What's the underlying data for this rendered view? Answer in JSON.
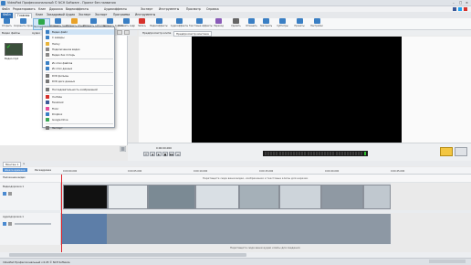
{
  "title_bar": {
    "title": "VideoPad Профессиональный © NCH Software - Проект без названия"
  },
  "menu": [
    "Файл",
    "Редактировать",
    "Клип",
    "Дорожка",
    "Видеоэффекты",
    "Аудиоэффекты",
    "Эксперт",
    "Инструменты",
    "Просмотр",
    "Справка"
  ],
  "tabs": [
    "Файл",
    "Главная",
    "Клип",
    "Закадровый",
    "Аудио",
    "Эксперт",
    "Экспорт",
    "Программа",
    "Инструменты"
  ],
  "ribbon": [
    {
      "label": "Открыть",
      "color": "#3a7fc4"
    },
    {
      "label": "Сохранить проект",
      "color": "#3a7fc4"
    },
    {
      "label": "Экспортировать файлы",
      "color": "#2ea84a"
    },
    {
      "label": "Добавить текст",
      "color": "#3a7fc4"
    },
    {
      "label": "Добавить объект",
      "color": "#e8a22a"
    },
    {
      "label": "Добавить субтитры",
      "color": "#3a7fc4"
    },
    {
      "label": "Добавить пустой",
      "color": "#3a7fc4"
    },
    {
      "label": "Добавить кадр",
      "color": "#3a7fc4"
    },
    {
      "label": "Запись",
      "color": "#d6312b"
    },
    {
      "label": "Видеоэффекты",
      "color": "#3a7fc4"
    },
    {
      "label": "Аудиоэффекты",
      "color": "#3a7fc4"
    },
    {
      "label": "Текстовые эффекты",
      "color": "#3a7fc4"
    },
    {
      "label": "Переход",
      "color": "#8a5bb8"
    },
    {
      "label": "Удалить",
      "color": "#666666"
    },
    {
      "label": "Отменить",
      "color": "#3a7fc4"
    },
    {
      "label": "Повторить",
      "color": "#3a7fc4"
    },
    {
      "label": "Субтитры",
      "color": "#3a7fc4"
    },
    {
      "label": "Проекты",
      "color": "#3a7fc4"
    },
    {
      "label": "Настройки",
      "color": "#3a7fc4"
    }
  ],
  "left_panel": {
    "tabs": [
      "Видео файлы",
      "Аудио",
      "Изображения",
      "Последовательности"
    ],
    "thumb_label": "Видео.mp4"
  },
  "dropdown": {
    "items": [
      {
        "label": "Видео файл",
        "color": "#3a7fc4"
      },
      {
        "label": "С камеры",
        "color": "#3a7fc4"
      },
      {
        "label": "Папку",
        "color": "#e8b339"
      },
      {
        "label": "Подключенное видео",
        "color": "#888888"
      },
      {
        "label": "Видео без потерь",
        "color": "#888888"
      },
      {
        "label": "Из этих файлов",
        "color": "#3a7fc4"
      },
      {
        "label": "Из этих данных",
        "color": "#3a7fc4"
      },
      {
        "label": "DVD фильмы",
        "color": "#777777"
      },
      {
        "label": "DVD диск данных",
        "color": "#777777"
      },
      {
        "label": "Последовательность изображений",
        "color": "#777777"
      },
      {
        "label": "YouTube",
        "color": "#d6312b"
      },
      {
        "label": "Facebook",
        "color": "#3b5998"
      },
      {
        "label": "Flickr",
        "color": "#e84a9a"
      },
      {
        "label": "Dropbox",
        "color": "#3a7fc4"
      },
      {
        "label": "Google Drive",
        "color": "#3aa855"
      },
      {
        "label": "Экспорт",
        "color": "#777777"
      }
    ]
  },
  "preview_tabs": [
    "Предпросмотр клипа",
    "Предпросмотр монтажа"
  ],
  "controls": {
    "timecode": "0:00:00.000",
    "buttons": [
      "⏮",
      "◀",
      "▶",
      "■",
      "▶▶",
      "⏭"
    ]
  },
  "project_tabs": [
    "Монтаж 1",
    "×"
  ],
  "timeline": {
    "header": [
      "Шкала времени",
      "Раскадровка"
    ],
    "ticks": [
      "0:00:00.000",
      "0:00:05.000",
      "0:00:10.000",
      "0:00:15.000",
      "0:00:20.000",
      "0:00:25.000"
    ],
    "hint_video": "Перетащите сюда ваши видео, изображения и текстовые клипы для нарезки",
    "hint_audio": "Перетащите сюда ваши аудио клипы для сведения",
    "overlay_label": "Наложение видео",
    "video_track_label": "Видеодорожка 1",
    "audio_track_label": "Аудиодорожка 1"
  },
  "status_bar": {
    "text": "VideoPad Профессиональный v 6.05 © NCH Software"
  }
}
